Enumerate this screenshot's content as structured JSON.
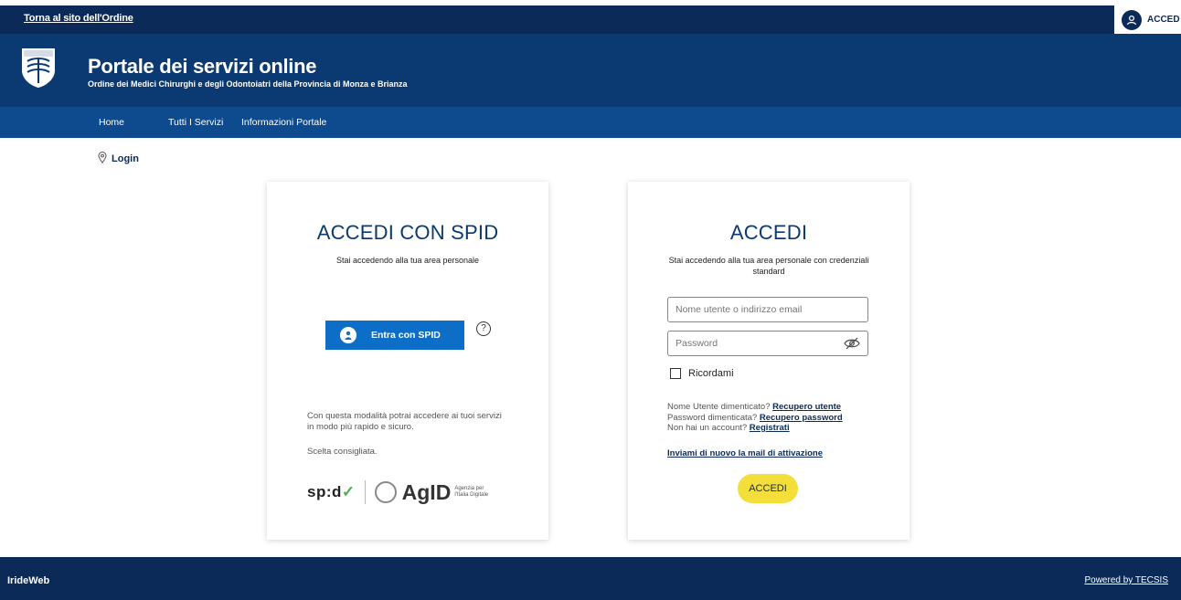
{
  "topbar": {
    "back_link": "Torna al sito dell'Ordine",
    "login_label": "ACCED"
  },
  "header": {
    "title": "Portale dei servizi online",
    "subtitle": "Ordine dei Medici Chirurghi e degli Odontoiatri della Provincia di Monza e Brianza"
  },
  "nav": {
    "items": [
      "Home",
      "Tutti I Servizi",
      "Informazioni Portale"
    ]
  },
  "breadcrumb": {
    "label": "Login"
  },
  "spid_card": {
    "title": "ACCEDI CON SPID",
    "description": "Stai accedendo alla tua area personale",
    "button_label": "Entra con SPID",
    "note": "Con questa modalità potrai accedere ai tuoi servizi in modo più rapido e sicuro.",
    "recommended": "Scelta consigliata.",
    "logo_spid": "sp:d",
    "logo_agid": "AgID",
    "logo_agid_sub": "Agenzia per l'Italia Digitale"
  },
  "login_card": {
    "title": "ACCEDI",
    "description": "Stai accedendo alla tua area personale con credenziali standard",
    "username_placeholder": "Nome utente o indirizzo email",
    "password_placeholder": "Password",
    "remember_label": "Ricordami",
    "forgot_user_text": "Nome Utente dimenticato?",
    "forgot_user_link": "Recupero utente",
    "forgot_pass_text": "Password dimenticata?",
    "forgot_pass_link": "Recupero password",
    "no_account_text": "Non hai un account?",
    "register_link": "Registrati",
    "resend_link": "Inviami di nuovo la mail di attivazione",
    "submit_label": "ACCEDI"
  },
  "footer": {
    "brand": "IrideWeb",
    "powered": "Powered by TECSIS"
  },
  "colors": {
    "topbar": "#0b2a57",
    "header": "#0b3a72",
    "nav": "#0d4a8e",
    "spid_button": "#0d6ec8",
    "submit_button": "#f4df3a"
  }
}
